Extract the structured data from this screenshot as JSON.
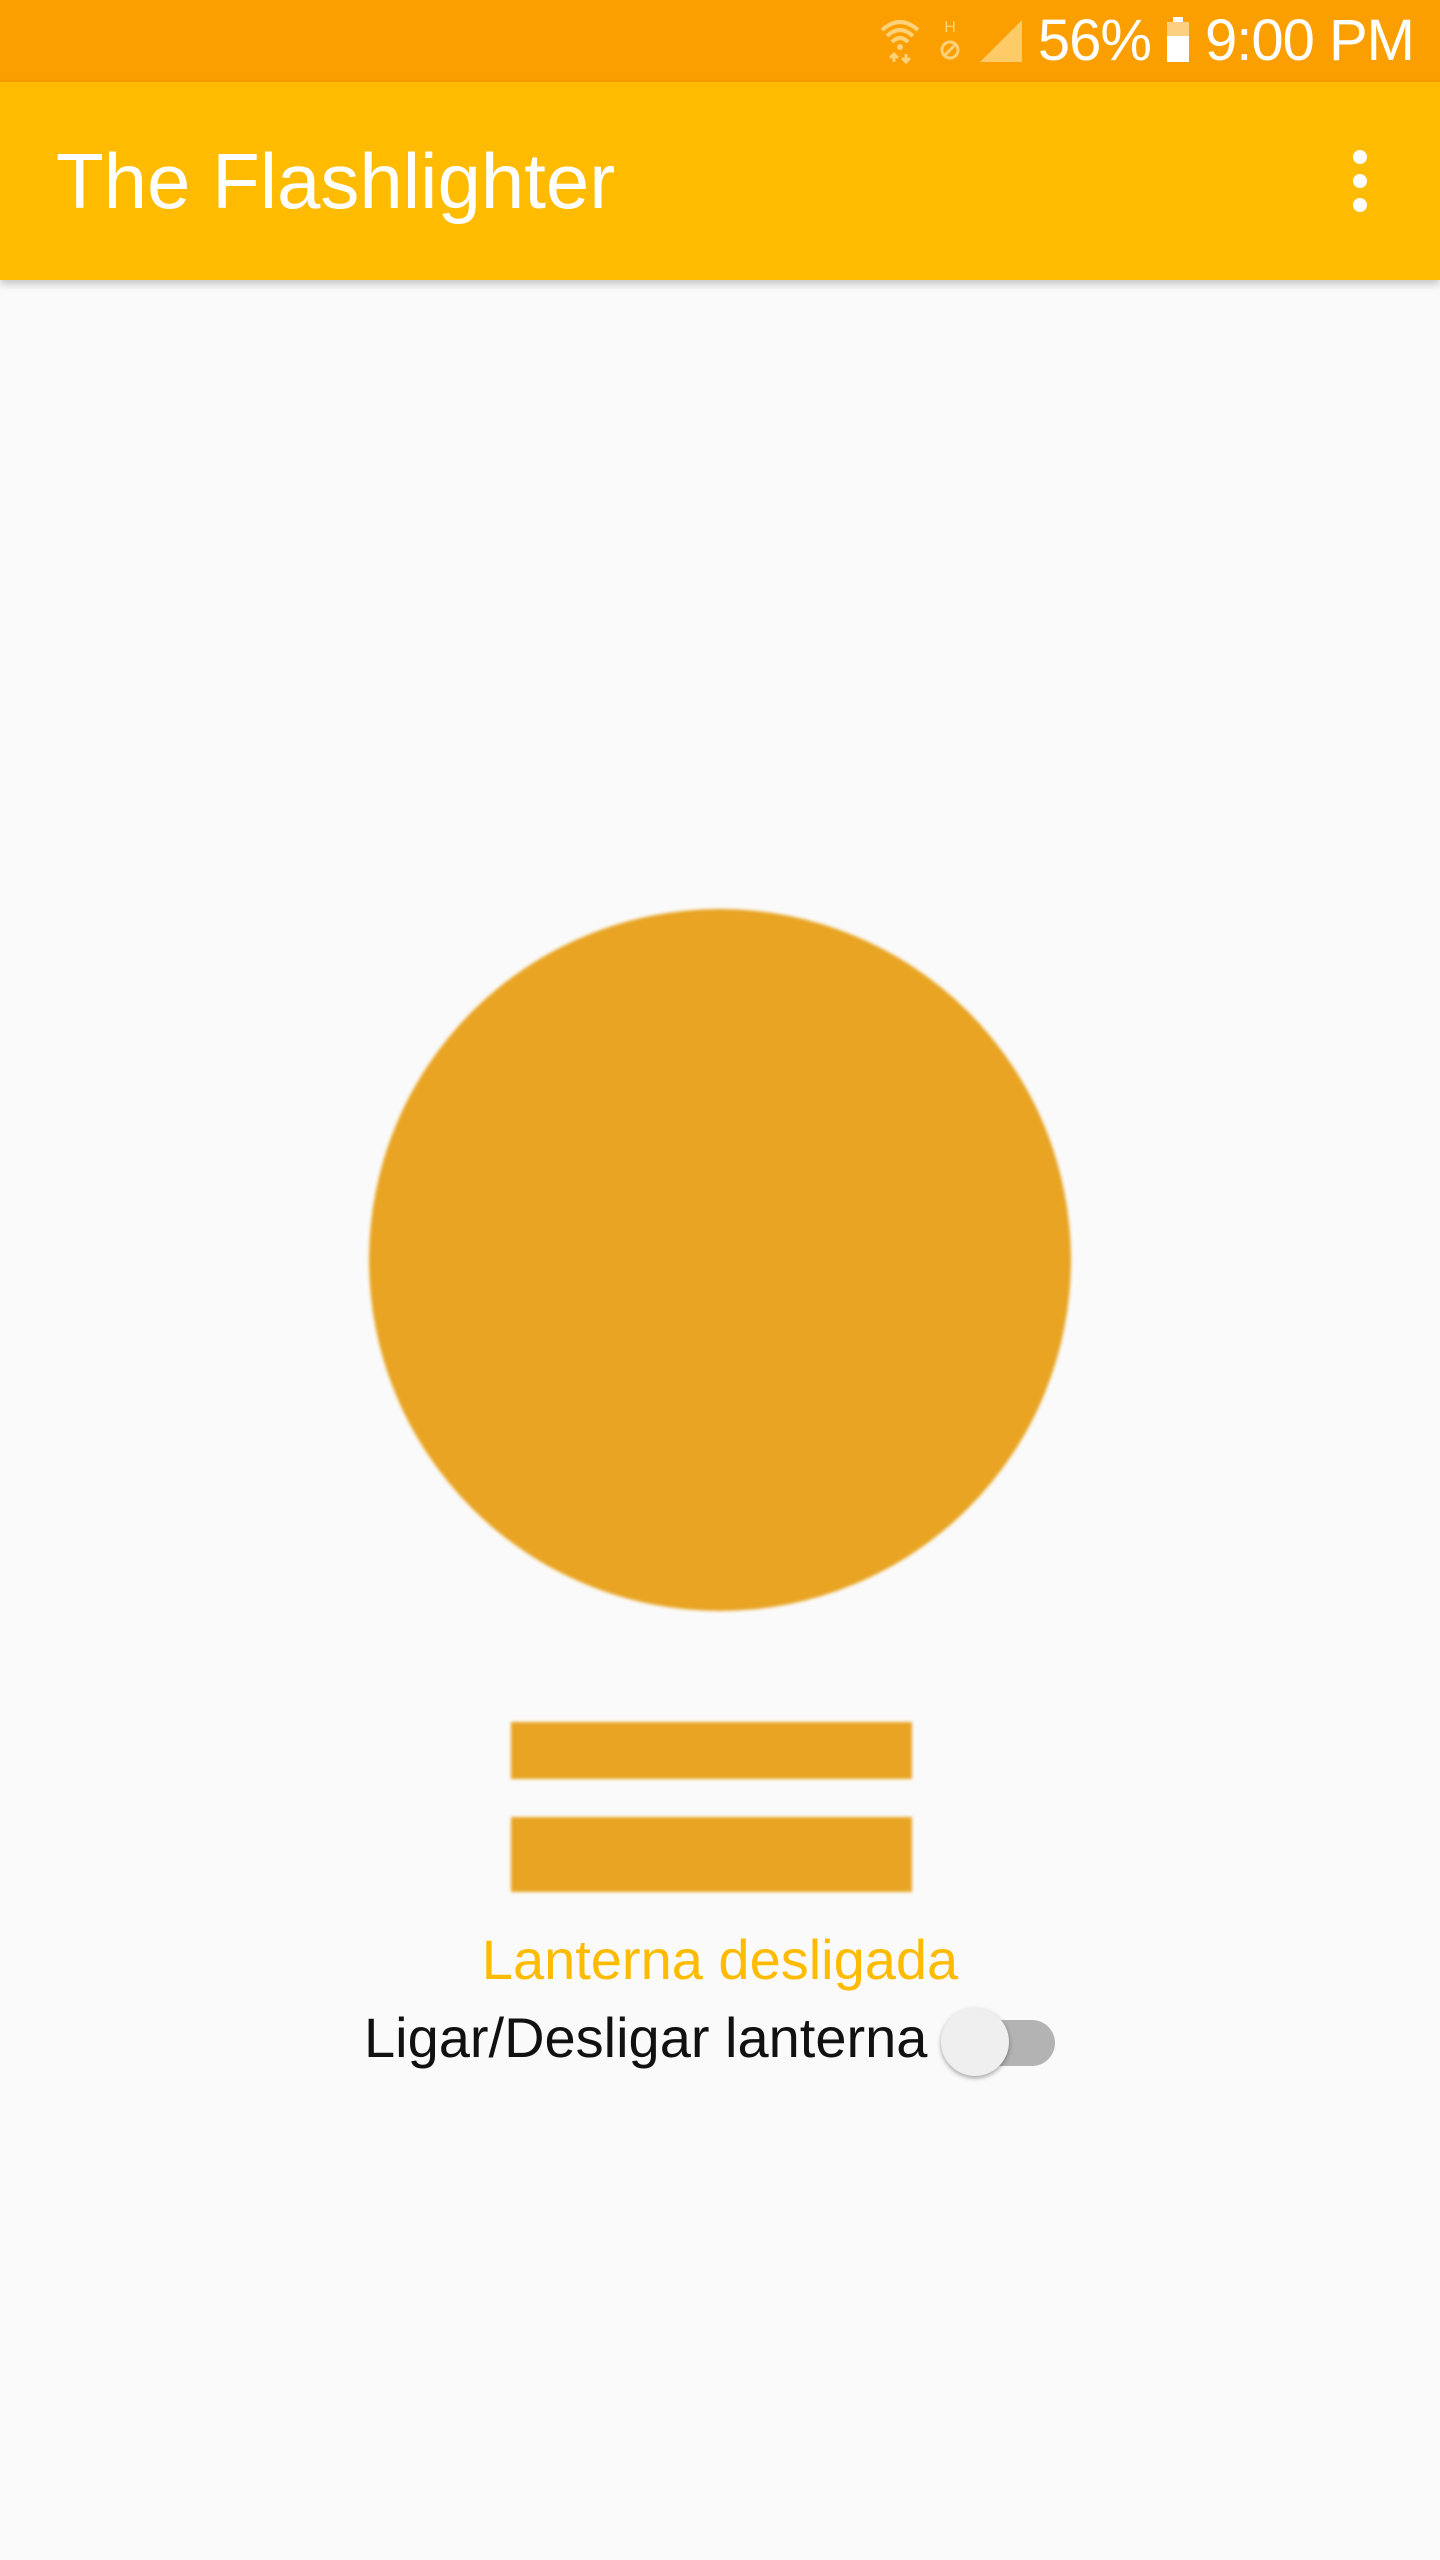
{
  "status_bar": {
    "battery_percent": "56%",
    "time": "9:00 PM",
    "icons": [
      "wifi-icon",
      "hd-voice-icon",
      "signal-icon",
      "battery-icon"
    ]
  },
  "app_bar": {
    "title": "The Flashlighter",
    "overflow_icon": "more-vert-icon"
  },
  "main": {
    "bulb_icon": "lightbulb-icon",
    "flashlight_status": "Lanterna desligada",
    "switch_label": "Ligar/Desligar lanterna",
    "switch_state": "off"
  },
  "colors": {
    "status_bar": "#fb9f00",
    "app_bar": "#ffbb00",
    "bulb": "#e8a422",
    "status_text": "#ffbb00",
    "background": "#fafafa"
  }
}
